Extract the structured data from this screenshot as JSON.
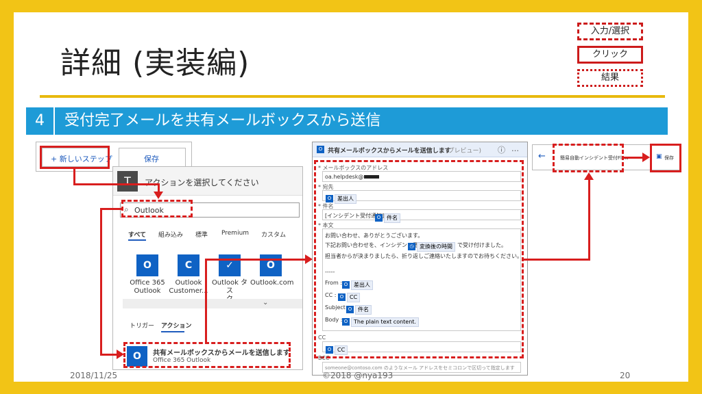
{
  "slide": {
    "title": "詳細 (実装編)",
    "step_number": "4",
    "step_title": "受付完了メールを共有メールボックスから送信",
    "footer": {
      "date": "2018/11/25",
      "copyright": "©2018 @nya193",
      "page": "20"
    },
    "legend": {
      "input_select": "入力/選択",
      "click": "クリック",
      "result": "結果"
    }
  },
  "flow_toolbar": {
    "new_step": "+ 新しいステップ",
    "save": "保存"
  },
  "action_picker": {
    "header": "アクションを選択してください",
    "search_value": "Outlook",
    "tabs": [
      "すべて",
      "組み込み",
      "標準",
      "Premium",
      "カスタム"
    ],
    "connectors": [
      {
        "label1": "Office 365",
        "label2": "Outlook"
      },
      {
        "label1": "Outlook",
        "label2": "Customer..."
      },
      {
        "label1": "Outlook タス",
        "label2": "ク"
      },
      {
        "label1": "Outlook.com",
        "label2": ""
      }
    ],
    "subtabs": [
      "トリガー",
      "アクション"
    ],
    "result": {
      "title": "共有メールボックスからメールを送信します",
      "subtitle": "Office 365 Outlook"
    }
  },
  "send_mail_card": {
    "header": "共有メールボックスからメールを送信します",
    "preview": "(プレビュー)",
    "mailbox_label": "* メールボックスのアドレス",
    "mailbox_value": "oa.helpdesk@",
    "to_label": "* 宛先",
    "to_token": "差出人",
    "subject_label": "* 件名",
    "subject_prefix": "[インシデント受付通知]",
    "subject_token": "件名",
    "body_label": "* 本文",
    "body_line1": "お問い合わせ、ありがとうございます。",
    "body_line2_pre": "下記お問い合わせを、インシデント番号",
    "body_line2_token": "変換後の時間",
    "body_line2_post": "で受け付けました。",
    "body_line3": "担当者からが決まりましたら、折り返しご連絡いたしますのでお待ちください。",
    "body_sep": "-----",
    "from_label": "From :",
    "from_token": "差出人",
    "cc_label": "CC :",
    "cc_token": "CC",
    "subj2_label": "Subject :",
    "subj2_token": "件名",
    "bodyref_label": "Body :",
    "bodyref_token": "The plain text content.",
    "cc_field_label": "CC",
    "cc_field_token": "CC",
    "bcc_label": "BCC",
    "bcc_placeholder": "someone@contoso.com のようなメール アドレスをセミコロンで区切って指定します"
  },
  "flow_header": {
    "name": "簡易自動インシデント受付Flow",
    "save": "保存"
  }
}
